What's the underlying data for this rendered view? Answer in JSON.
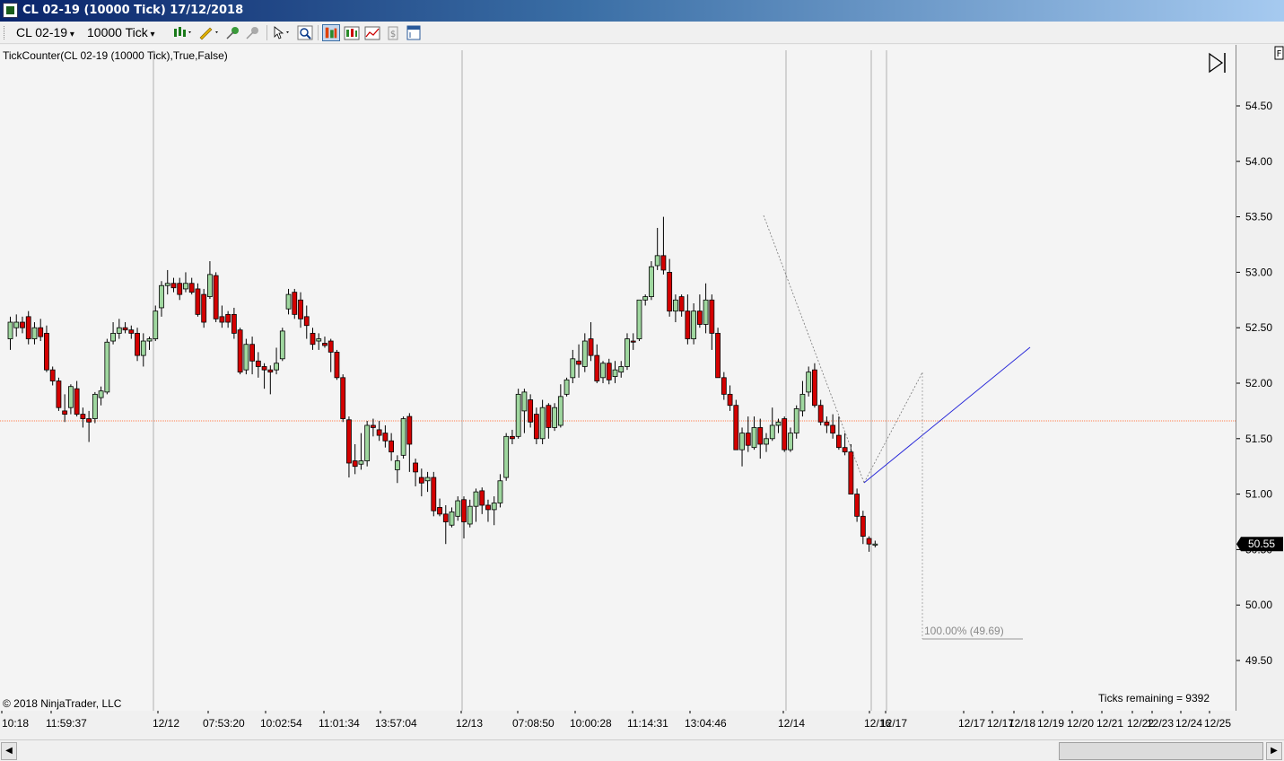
{
  "window": {
    "title": "CL 02-19 (10000 Tick)  17/12/2018"
  },
  "toolbar": {
    "instrument": "CL 02-19",
    "interval": "10000 Tick",
    "icons": [
      "bar-type-icon",
      "drawing-tool-icon",
      "pin-icon",
      "unpin-icon",
      "cursor-icon",
      "zoom-icon",
      "data-box-icon",
      "chart-trader-icon",
      "indicators-icon",
      "strategies-icon",
      "properties-icon"
    ]
  },
  "indicator_label": "TickCounter(CL  02-19  (10000  Tick),True,False)",
  "copyright": "© 2018 NinjaTrader, LLC",
  "ticks_remaining": "Ticks remaining = 9392",
  "fib_label": "100.00% (49.69)",
  "last_price": "50.55",
  "f_button": "F",
  "colors": {
    "up_body": "#9fd79f",
    "down_body": "#d40000",
    "wick": "#000000",
    "trendline": "#2b2bd9",
    "last_price_line": "#ff7f50",
    "background": "#f4f4f4"
  },
  "chart_data": {
    "type": "candlestick",
    "y_ticks": [
      "54.50",
      "54.00",
      "53.50",
      "53.00",
      "52.50",
      "52.00",
      "51.50",
      "51.00",
      "50.50",
      "50.00",
      "49.50"
    ],
    "ylim": [
      49.25,
      54.9
    ],
    "x_tick_labels": [
      "10:18",
      "11:59:37",
      "12/12",
      "07:53:20",
      "10:02:54",
      "11:01:34",
      "13:57:04",
      "12/13",
      "07:08:50",
      "10:00:28",
      "11:14:31",
      "13:04:46",
      "12/14",
      "12/16",
      "12/17",
      "12/17",
      "12/17",
      "12/18",
      "12/19",
      "12/20",
      "12/21",
      "12/22",
      "12/23",
      "12/24",
      "12/25"
    ],
    "last_price": 50.55,
    "candles": [
      {
        "o": 52.4,
        "h": 52.6,
        "l": 52.3,
        "c": 52.55
      },
      {
        "o": 52.5,
        "h": 52.62,
        "l": 52.42,
        "c": 52.55
      },
      {
        "o": 52.55,
        "h": 52.6,
        "l": 52.45,
        "c": 52.5
      },
      {
        "o": 52.6,
        "h": 52.65,
        "l": 52.35,
        "c": 52.4
      },
      {
        "o": 52.4,
        "h": 52.55,
        "l": 52.35,
        "c": 52.5
      },
      {
        "o": 52.5,
        "h": 52.58,
        "l": 52.38,
        "c": 52.42
      },
      {
        "o": 52.45,
        "h": 52.52,
        "l": 52.1,
        "c": 52.12
      },
      {
        "o": 52.12,
        "h": 52.15,
        "l": 51.98,
        "c": 52.02
      },
      {
        "o": 52.02,
        "h": 52.05,
        "l": 51.75,
        "c": 51.78
      },
      {
        "o": 51.75,
        "h": 51.9,
        "l": 51.65,
        "c": 51.72
      },
      {
        "o": 51.78,
        "h": 51.99,
        "l": 51.72,
        "c": 51.97
      },
      {
        "o": 51.95,
        "h": 52.02,
        "l": 51.7,
        "c": 51.72
      },
      {
        "o": 51.72,
        "h": 51.78,
        "l": 51.6,
        "c": 51.68
      },
      {
        "o": 51.68,
        "h": 51.75,
        "l": 51.47,
        "c": 51.65
      },
      {
        "o": 51.68,
        "h": 51.92,
        "l": 51.64,
        "c": 51.9
      },
      {
        "o": 51.87,
        "h": 51.97,
        "l": 51.8,
        "c": 51.93
      },
      {
        "o": 51.92,
        "h": 52.4,
        "l": 51.9,
        "c": 52.37
      },
      {
        "o": 52.38,
        "h": 52.55,
        "l": 52.35,
        "c": 52.45
      },
      {
        "o": 52.45,
        "h": 52.58,
        "l": 52.4,
        "c": 52.5
      },
      {
        "o": 52.5,
        "h": 52.55,
        "l": 52.45,
        "c": 52.48
      },
      {
        "o": 52.48,
        "h": 52.52,
        "l": 52.4,
        "c": 52.45
      },
      {
        "o": 52.45,
        "h": 52.5,
        "l": 52.2,
        "c": 52.25
      },
      {
        "o": 52.25,
        "h": 52.45,
        "l": 52.15,
        "c": 52.38
      },
      {
        "o": 52.38,
        "h": 52.42,
        "l": 52.3,
        "c": 52.4
      },
      {
        "o": 52.4,
        "h": 52.7,
        "l": 52.38,
        "c": 52.65
      },
      {
        "o": 52.68,
        "h": 52.92,
        "l": 52.6,
        "c": 52.88
      },
      {
        "o": 52.88,
        "h": 53.02,
        "l": 52.8,
        "c": 52.9
      },
      {
        "o": 52.9,
        "h": 52.95,
        "l": 52.82,
        "c": 52.86
      },
      {
        "o": 52.9,
        "h": 52.95,
        "l": 52.75,
        "c": 52.8
      },
      {
        "o": 52.85,
        "h": 53.0,
        "l": 52.82,
        "c": 52.9
      },
      {
        "o": 52.9,
        "h": 52.95,
        "l": 52.8,
        "c": 52.82
      },
      {
        "o": 52.85,
        "h": 52.9,
        "l": 52.6,
        "c": 52.62
      },
      {
        "o": 52.8,
        "h": 52.85,
        "l": 52.5,
        "c": 52.55
      },
      {
        "o": 52.78,
        "h": 53.1,
        "l": 52.76,
        "c": 52.98
      },
      {
        "o": 52.97,
        "h": 53.0,
        "l": 52.55,
        "c": 52.58
      },
      {
        "o": 52.6,
        "h": 52.7,
        "l": 52.5,
        "c": 52.55
      },
      {
        "o": 52.62,
        "h": 52.65,
        "l": 52.5,
        "c": 52.55
      },
      {
        "o": 52.62,
        "h": 52.68,
        "l": 52.4,
        "c": 52.45
      },
      {
        "o": 52.48,
        "h": 52.5,
        "l": 52.08,
        "c": 52.1
      },
      {
        "o": 52.12,
        "h": 52.4,
        "l": 52.08,
        "c": 52.35
      },
      {
        "o": 52.35,
        "h": 52.42,
        "l": 52.08,
        "c": 52.2
      },
      {
        "o": 52.2,
        "h": 52.28,
        "l": 52.05,
        "c": 52.15
      },
      {
        "o": 52.15,
        "h": 52.18,
        "l": 51.95,
        "c": 52.12
      },
      {
        "o": 52.12,
        "h": 52.16,
        "l": 51.9,
        "c": 52.1
      },
      {
        "o": 52.12,
        "h": 52.32,
        "l": 52.08,
        "c": 52.18
      },
      {
        "o": 52.22,
        "h": 52.5,
        "l": 52.2,
        "c": 52.47
      },
      {
        "o": 52.67,
        "h": 52.85,
        "l": 52.62,
        "c": 52.8
      },
      {
        "o": 52.82,
        "h": 52.85,
        "l": 52.58,
        "c": 52.62
      },
      {
        "o": 52.75,
        "h": 52.82,
        "l": 52.5,
        "c": 52.58
      },
      {
        "o": 52.6,
        "h": 52.7,
        "l": 52.4,
        "c": 52.52
      },
      {
        "o": 52.45,
        "h": 52.5,
        "l": 52.3,
        "c": 52.35
      },
      {
        "o": 52.38,
        "h": 52.45,
        "l": 52.3,
        "c": 52.4
      },
      {
        "o": 52.36,
        "h": 52.42,
        "l": 52.32,
        "c": 52.34
      },
      {
        "o": 52.38,
        "h": 52.4,
        "l": 52.1,
        "c": 52.28
      },
      {
        "o": 52.28,
        "h": 52.3,
        "l": 52.03,
        "c": 52.05
      },
      {
        "o": 52.05,
        "h": 52.08,
        "l": 51.65,
        "c": 51.68
      },
      {
        "o": 51.67,
        "h": 51.7,
        "l": 51.15,
        "c": 51.28
      },
      {
        "o": 51.3,
        "h": 51.45,
        "l": 51.18,
        "c": 51.25
      },
      {
        "o": 51.27,
        "h": 51.55,
        "l": 51.22,
        "c": 51.3
      },
      {
        "o": 51.3,
        "h": 51.66,
        "l": 51.25,
        "c": 51.62
      },
      {
        "o": 51.62,
        "h": 51.68,
        "l": 51.52,
        "c": 51.6
      },
      {
        "o": 51.58,
        "h": 51.66,
        "l": 51.48,
        "c": 51.53
      },
      {
        "o": 51.55,
        "h": 51.62,
        "l": 51.42,
        "c": 51.48
      },
      {
        "o": 51.48,
        "h": 51.55,
        "l": 51.3,
        "c": 51.38
      },
      {
        "o": 51.22,
        "h": 51.35,
        "l": 51.1,
        "c": 51.3
      },
      {
        "o": 51.35,
        "h": 51.7,
        "l": 51.32,
        "c": 51.68
      },
      {
        "o": 51.7,
        "h": 51.73,
        "l": 51.2,
        "c": 51.45
      },
      {
        "o": 51.28,
        "h": 51.32,
        "l": 51.07,
        "c": 51.2
      },
      {
        "o": 51.15,
        "h": 51.23,
        "l": 50.98,
        "c": 51.1
      },
      {
        "o": 51.12,
        "h": 51.2,
        "l": 51.02,
        "c": 51.15
      },
      {
        "o": 51.15,
        "h": 51.2,
        "l": 50.8,
        "c": 50.85
      },
      {
        "o": 50.88,
        "h": 50.96,
        "l": 50.8,
        "c": 50.82
      },
      {
        "o": 50.82,
        "h": 50.9,
        "l": 50.55,
        "c": 50.75
      },
      {
        "o": 50.72,
        "h": 50.88,
        "l": 50.7,
        "c": 50.84
      },
      {
        "o": 50.8,
        "h": 50.98,
        "l": 50.76,
        "c": 50.94
      },
      {
        "o": 50.95,
        "h": 50.98,
        "l": 50.6,
        "c": 50.75
      },
      {
        "o": 50.73,
        "h": 50.95,
        "l": 50.7,
        "c": 50.89
      },
      {
        "o": 50.89,
        "h": 51.05,
        "l": 50.75,
        "c": 51.02
      },
      {
        "o": 51.03,
        "h": 51.06,
        "l": 50.82,
        "c": 50.9
      },
      {
        "o": 50.9,
        "h": 50.95,
        "l": 50.75,
        "c": 50.86
      },
      {
        "o": 50.86,
        "h": 50.98,
        "l": 50.72,
        "c": 50.92
      },
      {
        "o": 50.92,
        "h": 51.18,
        "l": 50.88,
        "c": 51.12
      },
      {
        "o": 51.15,
        "h": 51.55,
        "l": 51.12,
        "c": 51.52
      },
      {
        "o": 51.52,
        "h": 51.58,
        "l": 51.45,
        "c": 51.5
      },
      {
        "o": 51.52,
        "h": 51.95,
        "l": 51.5,
        "c": 51.9
      },
      {
        "o": 51.75,
        "h": 51.95,
        "l": 51.55,
        "c": 51.92
      },
      {
        "o": 51.85,
        "h": 51.9,
        "l": 51.6,
        "c": 51.65
      },
      {
        "o": 51.72,
        "h": 51.78,
        "l": 51.45,
        "c": 51.5
      },
      {
        "o": 51.5,
        "h": 51.85,
        "l": 51.45,
        "c": 51.78
      },
      {
        "o": 51.8,
        "h": 51.82,
        "l": 51.5,
        "c": 51.6
      },
      {
        "o": 51.6,
        "h": 51.82,
        "l": 51.57,
        "c": 51.78
      },
      {
        "o": 51.62,
        "h": 51.99,
        "l": 51.6,
        "c": 51.88
      },
      {
        "o": 51.9,
        "h": 52.05,
        "l": 51.88,
        "c": 52.03
      },
      {
        "o": 52.05,
        "h": 52.3,
        "l": 52.0,
        "c": 52.22
      },
      {
        "o": 52.2,
        "h": 52.35,
        "l": 52.05,
        "c": 52.17
      },
      {
        "o": 52.15,
        "h": 52.45,
        "l": 52.1,
        "c": 52.38
      },
      {
        "o": 52.4,
        "h": 52.55,
        "l": 52.2,
        "c": 52.25
      },
      {
        "o": 52.25,
        "h": 52.35,
        "l": 52.0,
        "c": 52.02
      },
      {
        "o": 52.05,
        "h": 52.2,
        "l": 52.0,
        "c": 52.18
      },
      {
        "o": 52.18,
        "h": 52.22,
        "l": 51.99,
        "c": 52.03
      },
      {
        "o": 52.06,
        "h": 52.2,
        "l": 52.0,
        "c": 52.12
      },
      {
        "o": 52.1,
        "h": 52.2,
        "l": 52.05,
        "c": 52.15
      },
      {
        "o": 52.15,
        "h": 52.45,
        "l": 52.12,
        "c": 52.4
      },
      {
        "o": 52.38,
        "h": 52.45,
        "l": 52.3,
        "c": 52.37
      },
      {
        "o": 52.4,
        "h": 52.75,
        "l": 52.38,
        "c": 52.75
      },
      {
        "o": 52.75,
        "h": 52.8,
        "l": 52.7,
        "c": 52.78
      },
      {
        "o": 52.78,
        "h": 53.1,
        "l": 52.75,
        "c": 53.05
      },
      {
        "o": 53.06,
        "h": 53.4,
        "l": 53.02,
        "c": 53.15
      },
      {
        "o": 53.15,
        "h": 53.5,
        "l": 52.98,
        "c": 53.02
      },
      {
        "o": 53.0,
        "h": 53.12,
        "l": 52.6,
        "c": 52.65
      },
      {
        "o": 52.65,
        "h": 52.8,
        "l": 52.55,
        "c": 52.75
      },
      {
        "o": 52.78,
        "h": 52.8,
        "l": 52.6,
        "c": 52.65
      },
      {
        "o": 52.65,
        "h": 52.8,
        "l": 52.35,
        "c": 52.4
      },
      {
        "o": 52.4,
        "h": 52.72,
        "l": 52.35,
        "c": 52.65
      },
      {
        "o": 52.65,
        "h": 52.8,
        "l": 52.5,
        "c": 52.53
      },
      {
        "o": 52.53,
        "h": 52.9,
        "l": 52.45,
        "c": 52.75
      },
      {
        "o": 52.75,
        "h": 52.8,
        "l": 52.3,
        "c": 52.45
      },
      {
        "o": 52.45,
        "h": 52.5,
        "l": 52.05,
        "c": 52.05
      },
      {
        "o": 52.05,
        "h": 52.1,
        "l": 51.85,
        "c": 51.9
      },
      {
        "o": 51.9,
        "h": 51.98,
        "l": 51.75,
        "c": 51.8
      },
      {
        "o": 51.8,
        "h": 51.85,
        "l": 51.4,
        "c": 51.4
      },
      {
        "o": 51.4,
        "h": 51.6,
        "l": 51.25,
        "c": 51.55
      },
      {
        "o": 51.55,
        "h": 51.7,
        "l": 51.38,
        "c": 51.44
      },
      {
        "o": 51.42,
        "h": 51.7,
        "l": 51.4,
        "c": 51.6
      },
      {
        "o": 51.6,
        "h": 51.68,
        "l": 51.32,
        "c": 51.45
      },
      {
        "o": 51.45,
        "h": 51.55,
        "l": 51.38,
        "c": 51.5
      },
      {
        "o": 51.5,
        "h": 51.78,
        "l": 51.48,
        "c": 51.62
      },
      {
        "o": 51.62,
        "h": 51.68,
        "l": 51.55,
        "c": 51.65
      },
      {
        "o": 51.68,
        "h": 51.7,
        "l": 51.38,
        "c": 51.4
      },
      {
        "o": 51.4,
        "h": 51.6,
        "l": 51.38,
        "c": 51.55
      },
      {
        "o": 51.55,
        "h": 51.8,
        "l": 51.5,
        "c": 51.77
      },
      {
        "o": 51.75,
        "h": 52.02,
        "l": 51.7,
        "c": 51.9
      },
      {
        "o": 51.92,
        "h": 52.15,
        "l": 51.88,
        "c": 52.1
      },
      {
        "o": 52.12,
        "h": 52.18,
        "l": 51.78,
        "c": 51.8
      },
      {
        "o": 51.8,
        "h": 51.85,
        "l": 51.62,
        "c": 51.65
      },
      {
        "o": 51.65,
        "h": 51.7,
        "l": 51.55,
        "c": 51.62
      },
      {
        "o": 51.62,
        "h": 51.72,
        "l": 51.5,
        "c": 51.55
      },
      {
        "o": 51.53,
        "h": 51.7,
        "l": 51.4,
        "c": 51.42
      },
      {
        "o": 51.42,
        "h": 51.55,
        "l": 51.35,
        "c": 51.38
      },
      {
        "o": 51.38,
        "h": 51.45,
        "l": 51.0,
        "c": 51.0
      },
      {
        "o": 51.0,
        "h": 51.05,
        "l": 50.75,
        "c": 50.8
      },
      {
        "o": 50.8,
        "h": 50.85,
        "l": 50.55,
        "c": 50.62
      },
      {
        "o": 50.6,
        "h": 50.62,
        "l": 50.48,
        "c": 50.55
      },
      {
        "o": 50.54,
        "h": 50.58,
        "l": 50.52,
        "c": 50.55
      }
    ]
  }
}
